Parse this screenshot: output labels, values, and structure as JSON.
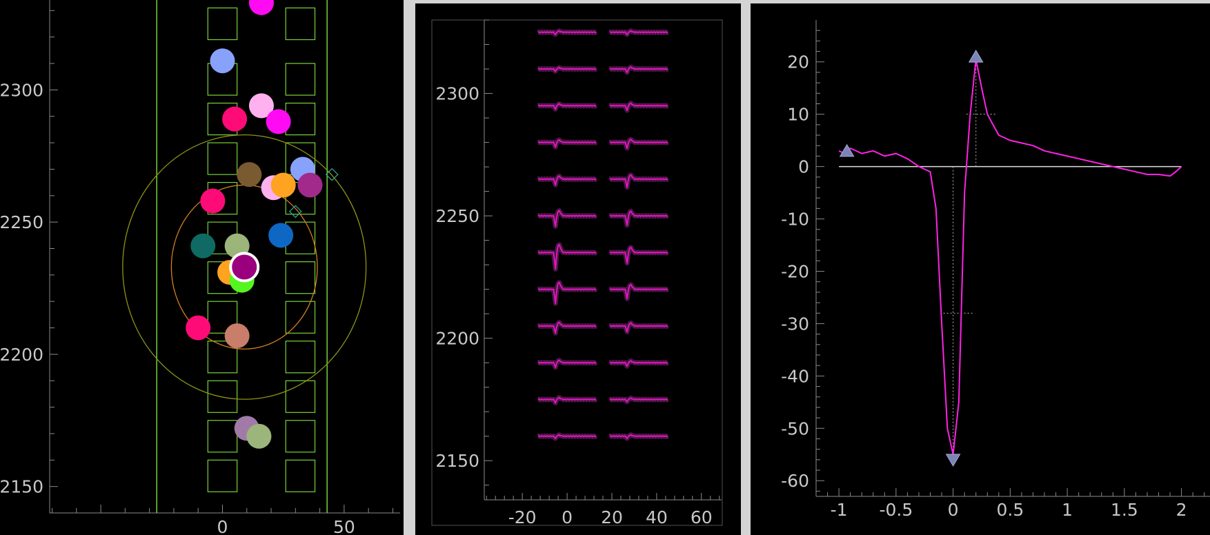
{
  "colors": {
    "background": "#000000",
    "panel_divider": "#d4d4d4",
    "axis": "#8c8c8c",
    "tick_label": "#c8c8c8",
    "site_outline": "#7bd33a",
    "waveform": "#e815c8",
    "waveform_band": "#4a1642",
    "template": "#ff22e6",
    "marker": "#7d84b8",
    "zero_line": "#e0e0e0",
    "inner_ring": "#d0801f",
    "outer_ring": "#8e9515"
  },
  "chart_data": [
    {
      "type": "scatter",
      "ylim": [
        2140,
        2334
      ],
      "xlim": [
        -71,
        73
      ],
      "yticks": [
        2150,
        2200,
        2250,
        2300
      ],
      "xticks": [
        0,
        50
      ],
      "shank_edges_x": [
        -27,
        43
      ],
      "site_columns_x": [
        0,
        32
      ],
      "site_rows_y": [
        2325,
        2304,
        2289,
        2274,
        2259,
        2244,
        2229,
        2214,
        2199,
        2184,
        2169,
        2154
      ],
      "rings": [
        {
          "center": [
            9,
            2233
          ],
          "radius_x": 30,
          "radius_y": 31,
          "color": "#d0801f"
        },
        {
          "center": [
            9,
            2233
          ],
          "radius_x": 50,
          "radius_y": 50,
          "color": "#8e9515"
        }
      ],
      "diamonds": [
        [
          45,
          2268
        ],
        [
          30,
          2254
        ]
      ],
      "units": [
        {
          "x": 16,
          "y": 2333,
          "color": "#ff0bf3"
        },
        {
          "x": 0,
          "y": 2311,
          "color": "#88a2fb"
        },
        {
          "x": 16,
          "y": 2294,
          "color": "#ffb0ee"
        },
        {
          "x": 5,
          "y": 2289,
          "color": "#ff0b78"
        },
        {
          "x": 23,
          "y": 2288,
          "color": "#ff0bf3"
        },
        {
          "x": 11,
          "y": 2268,
          "color": "#7a5a30"
        },
        {
          "x": 33,
          "y": 2270,
          "color": "#88a2fb"
        },
        {
          "x": 36,
          "y": 2264,
          "color": "#a12a8a"
        },
        {
          "x": 21,
          "y": 2263,
          "color": "#ffb0ee"
        },
        {
          "x": 25,
          "y": 2264,
          "color": "#ffa320"
        },
        {
          "x": -4,
          "y": 2258,
          "color": "#ff0b78"
        },
        {
          "x": 24,
          "y": 2245,
          "color": "#0f67c4"
        },
        {
          "x": -8,
          "y": 2241,
          "color": "#0f6a63"
        },
        {
          "x": 6,
          "y": 2241,
          "color": "#9bb57a"
        },
        {
          "x": 3,
          "y": 2231,
          "color": "#ffa320"
        },
        {
          "x": 8,
          "y": 2228,
          "color": "#55f51f"
        },
        {
          "x": 9,
          "y": 2233,
          "color": "#9a007e",
          "selected": true
        },
        {
          "x": -10,
          "y": 2210,
          "color": "#ff0b78"
        },
        {
          "x": 6,
          "y": 2207,
          "color": "#c97d6b"
        },
        {
          "x": 10,
          "y": 2172,
          "color": "#a17aa8"
        },
        {
          "x": 15,
          "y": 2169,
          "color": "#9bb57a"
        }
      ]
    },
    {
      "type": "line",
      "ylim": [
        2134,
        2330
      ],
      "xlim": [
        -37,
        69
      ],
      "yticks": [
        2150,
        2200,
        2250,
        2300
      ],
      "xticks": [
        -20,
        0,
        20,
        40,
        60
      ],
      "channel_columns_x": [
        -13,
        19
      ],
      "channel_rows_y": [
        2325,
        2310,
        2295,
        2280,
        2265,
        2250,
        2235,
        2220,
        2205,
        2190,
        2175,
        2160
      ],
      "column_width": 26,
      "trough_time": 0.3,
      "row_amplitudes": [
        [
          2,
          2
        ],
        [
          2,
          3
        ],
        [
          3,
          4
        ],
        [
          4,
          5
        ],
        [
          5,
          7
        ],
        [
          9,
          8
        ],
        [
          14,
          9
        ],
        [
          12,
          8
        ],
        [
          6,
          5
        ],
        [
          4,
          3
        ],
        [
          3,
          2
        ],
        [
          2,
          2
        ]
      ]
    },
    {
      "type": "line",
      "xlim": [
        -1.2,
        2.25
      ],
      "ylim": [
        -63,
        28
      ],
      "xticks": [
        -1,
        -0.5,
        0,
        0.5,
        1,
        1.5,
        2
      ],
      "xtick_labels": [
        "-1",
        "-0.5",
        "0",
        "0.5",
        "1",
        "1.5",
        "2"
      ],
      "yticks": [
        -60,
        -50,
        -40,
        -30,
        -20,
        -10,
        0,
        10,
        20
      ],
      "x": [
        -1.0,
        -0.95,
        -0.9,
        -0.8,
        -0.7,
        -0.6,
        -0.5,
        -0.4,
        -0.3,
        -0.25,
        -0.2,
        -0.15,
        -0.1,
        -0.05,
        0.0,
        0.05,
        0.1,
        0.15,
        0.2,
        0.25,
        0.3,
        0.35,
        0.4,
        0.5,
        0.6,
        0.7,
        0.8,
        0.9,
        1.0,
        1.1,
        1.2,
        1.3,
        1.4,
        1.5,
        1.6,
        1.7,
        1.8,
        1.9,
        1.95,
        2.0
      ],
      "y": [
        3,
        2.5,
        3.5,
        2.5,
        3,
        2,
        2.5,
        1.5,
        0,
        -0.5,
        -1,
        -8,
        -30,
        -50,
        -55,
        -45,
        -5,
        10,
        20.5,
        15,
        10,
        8,
        6,
        5,
        4.5,
        4,
        3,
        2.5,
        2,
        1.5,
        1,
        0.5,
        0,
        -0.5,
        -1,
        -1.5,
        -1.5,
        -1.8,
        -1,
        0
      ],
      "peak_markers": [
        {
          "x": -0.93,
          "y": 3,
          "direction": "up"
        },
        {
          "x": 0.2,
          "y": 21,
          "direction": "up"
        },
        {
          "x": 0.0,
          "y": -56,
          "direction": "down"
        }
      ],
      "guides": [
        {
          "x": 0.0,
          "y": -28,
          "to_y": -55
        },
        {
          "x": 0.2,
          "y": 10,
          "to_y": 21
        }
      ]
    }
  ]
}
